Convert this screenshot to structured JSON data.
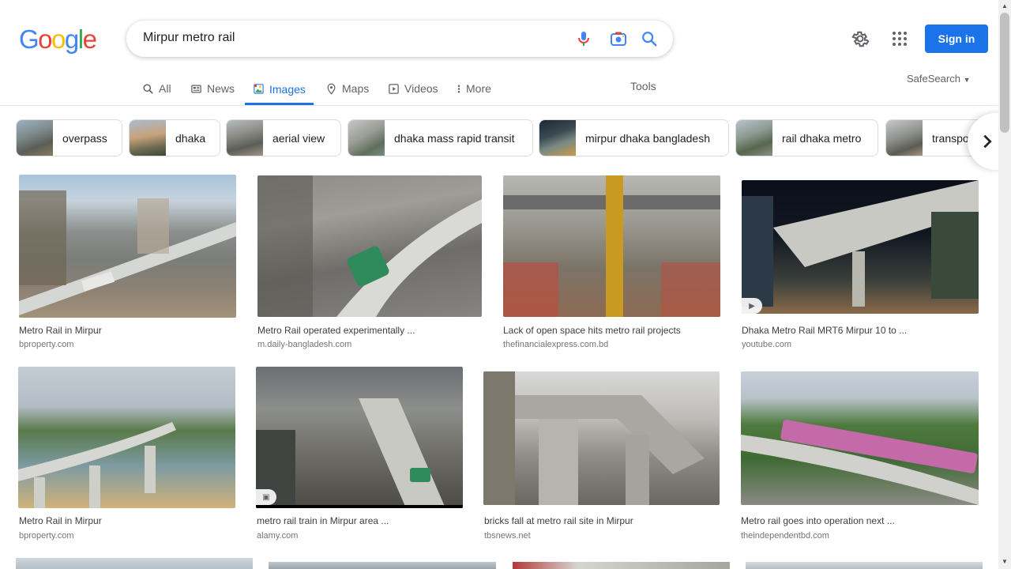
{
  "header": {
    "logo_letters": [
      {
        "ch": "G",
        "color": "#4285f4"
      },
      {
        "ch": "o",
        "color": "#ea4335"
      },
      {
        "ch": "o",
        "color": "#fbbc05"
      },
      {
        "ch": "g",
        "color": "#4285f4"
      },
      {
        "ch": "l",
        "color": "#34a853"
      },
      {
        "ch": "e",
        "color": "#ea4335"
      }
    ],
    "query": "Mirpur metro rail",
    "sign_in_label": "Sign in",
    "accent": "#1a73e8"
  },
  "tabs": [
    {
      "label": "All",
      "icon": "search-icon"
    },
    {
      "label": "News",
      "icon": "news-icon"
    },
    {
      "label": "Images",
      "icon": "images-icon",
      "active": true
    },
    {
      "label": "Maps",
      "icon": "map-pin-icon"
    },
    {
      "label": "Videos",
      "icon": "video-icon"
    },
    {
      "label": "More",
      "icon": "more-vert-icon"
    }
  ],
  "tools_label": "Tools",
  "safesearch_label": "SafeSearch",
  "chips": [
    {
      "label": "overpass"
    },
    {
      "label": "dhaka"
    },
    {
      "label": "aerial view"
    },
    {
      "label": "dhaka mass rapid transit"
    },
    {
      "label": "mirpur dhaka bangladesh"
    },
    {
      "label": "rail dhaka metro"
    },
    {
      "label": "transport"
    }
  ],
  "results_row1": [
    {
      "title": "Metro Rail in Mirpur",
      "source": "bproperty.com"
    },
    {
      "title": "Metro Rail operated experimentally ...",
      "source": "m.daily-bangladesh.com"
    },
    {
      "title": "Lack of open space hits metro rail projects",
      "source": "thefinancialexpress.com.bd"
    },
    {
      "title": "Dhaka Metro Rail MRT6 Mirpur 10 to ...",
      "source": "youtube.com",
      "badge": "play-icon"
    }
  ],
  "results_row2": [
    {
      "title": "Metro Rail in Mirpur",
      "source": "bproperty.com"
    },
    {
      "title": "metro rail train in Mirpur area ...",
      "source": "alamy.com",
      "badge": "image-icon"
    },
    {
      "title": "bricks fall at metro rail site in Mirpur",
      "source": "tbsnews.net"
    },
    {
      "title": "Metro rail goes into operation next ...",
      "source": "theindependentbd.com"
    }
  ]
}
